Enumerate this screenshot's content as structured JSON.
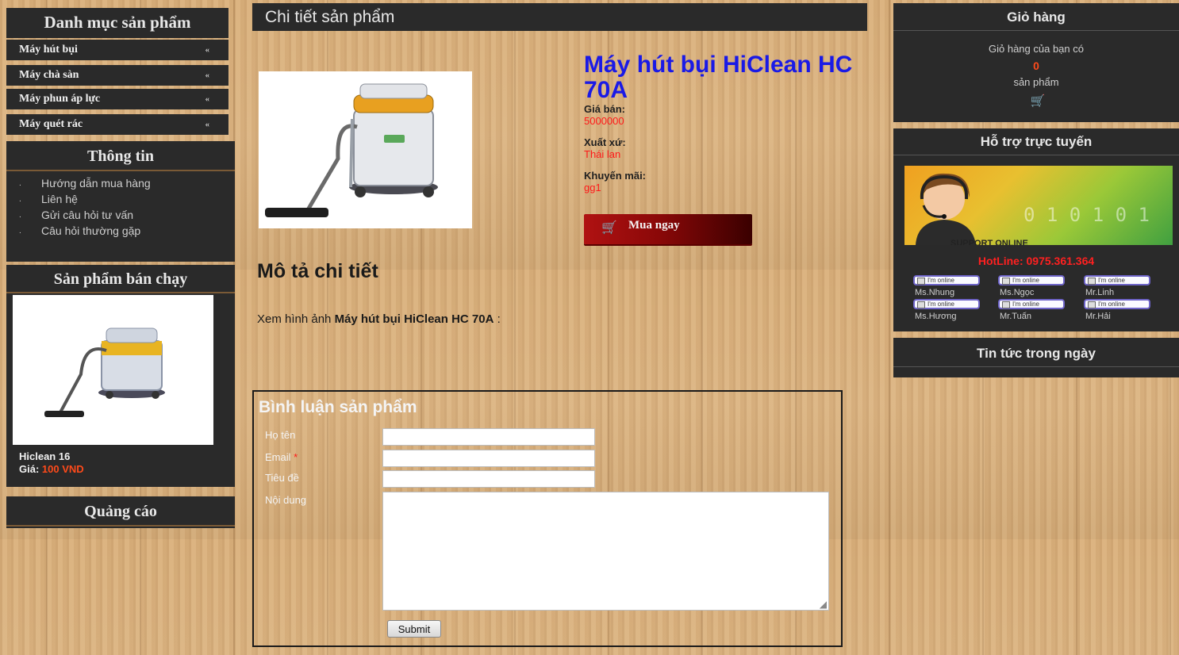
{
  "left": {
    "category_title": "Danh mục sản phẩm",
    "categories": [
      {
        "label": "Máy hút bụi"
      },
      {
        "label": "Máy chà sàn"
      },
      {
        "label": "Máy phun áp lực"
      },
      {
        "label": "Máy quét rác"
      }
    ],
    "arrow_glyph": "«",
    "info_title": "Thông tin",
    "info_links": [
      {
        "label": "Hướng dẫn mua hàng"
      },
      {
        "label": "Liên hệ"
      },
      {
        "label": "Gửi câu hỏi tư vấn"
      },
      {
        "label": "Câu hỏi thường gặp"
      }
    ],
    "info_bullet": ".",
    "bestseller_title": "Sản phẩm bán chạy",
    "bestseller_name": "Hiclean 16",
    "bestseller_price_label": "Giá:",
    "bestseller_price": "100 VND",
    "ads_title": "Quảng cáo"
  },
  "main": {
    "section_title": "Chi tiết sản phẩm",
    "product_name": "Máy hút bụi HiClean HC 70A",
    "price_label": "Giá bán:",
    "price_value": "5000000",
    "origin_label": "Xuất xứ:",
    "origin_value": "Thái lan",
    "promo_label": "Khuyến mãi:",
    "promo_value": "gg1",
    "buy_label": "Mua ngay",
    "description_title": "Mô tả chi tiết",
    "description_prefix": "Xem hình ảnh ",
    "description_bold": "Máy hút bụi HiClean HC 70A",
    "description_suffix": " :"
  },
  "comment": {
    "title": "Bình luận sản phẩm",
    "name_label": "Họ tên",
    "email_label": "Email",
    "required_mark": "*",
    "subject_label": "Tiêu đề",
    "content_label": "Nội dung",
    "submit_label": "Submit"
  },
  "right": {
    "cart_title": "Giỏ hàng",
    "cart_line1": "Giỏ hàng của bạn có",
    "cart_count": "0",
    "cart_line2": "sản phẩm",
    "support_title": "Hỗ trợ trực tuyến",
    "banner_text": "SUPPORT ONLINE",
    "hotline": "HotLine: 0975.361.364",
    "online_badge": "I'm online",
    "agents": [
      {
        "name": "Ms.Nhung"
      },
      {
        "name": "Ms.Ngọc"
      },
      {
        "name": "Mr.Linh"
      },
      {
        "name": "Ms.Hương"
      },
      {
        "name": "Mr.Tuấn"
      },
      {
        "name": "Mr.Hải"
      }
    ],
    "news_title": "Tin tức trong ngày"
  },
  "colors": {
    "panel": "#2a2a2a",
    "title_blue": "#1a1ae6",
    "value_red": "#ff1a1a",
    "price_orange": "#ff4a1a",
    "hotline_red": "#ff2020",
    "buy_button": "#8b0a0a"
  }
}
